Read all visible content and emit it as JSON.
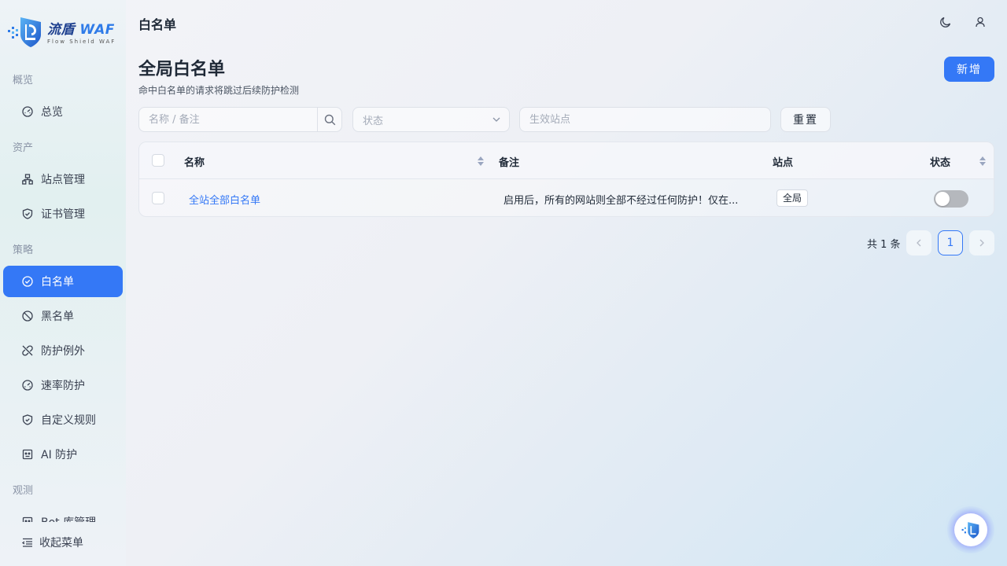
{
  "brand": {
    "name_cn": "流盾",
    "name_en": "WAF",
    "tagline": "Flow Shield WAF",
    "accent": "#3478f6"
  },
  "header": {
    "title": "白名单"
  },
  "sidebar": {
    "sections": [
      {
        "label": "概览"
      },
      {
        "label": "资产"
      },
      {
        "label": "策略"
      },
      {
        "label": "观测"
      }
    ],
    "items": [
      {
        "label": "总览",
        "icon": "dashboard-icon"
      },
      {
        "label": "站点管理",
        "icon": "sitemap-icon"
      },
      {
        "label": "证书管理",
        "icon": "shield-check-icon"
      },
      {
        "label": "白名单",
        "icon": "check-circle-icon",
        "active": true
      },
      {
        "label": "黑名单",
        "icon": "ban-icon"
      },
      {
        "label": "防护例外",
        "icon": "link-off-icon"
      },
      {
        "label": "速率防护",
        "icon": "gauge-icon"
      },
      {
        "label": "自定义规则",
        "icon": "shield-icon"
      },
      {
        "label": "AI 防护",
        "icon": "robot-icon"
      },
      {
        "label": "Bot 库管理",
        "icon": "bot-icon"
      }
    ],
    "collapse_label": "收起菜单"
  },
  "main": {
    "title": "全局白名单",
    "subtitle": "命中白名单的请求将跳过后续防护检测",
    "add_label": "新增"
  },
  "filters": {
    "search_placeholder": "名称 / 备注",
    "status_placeholder": "状态",
    "site_placeholder": "生效站点",
    "reset_label": "重置"
  },
  "table": {
    "columns": [
      "名称",
      "备注",
      "站点",
      "状态"
    ],
    "rows": [
      {
        "name": "全站全部白名单",
        "remark": "启用后，所有的网站则全部不经过任何防护！仅在...",
        "site": "全局",
        "enabled": false
      }
    ]
  },
  "pagination": {
    "total_text": "共 1 条",
    "current_page": "1"
  }
}
